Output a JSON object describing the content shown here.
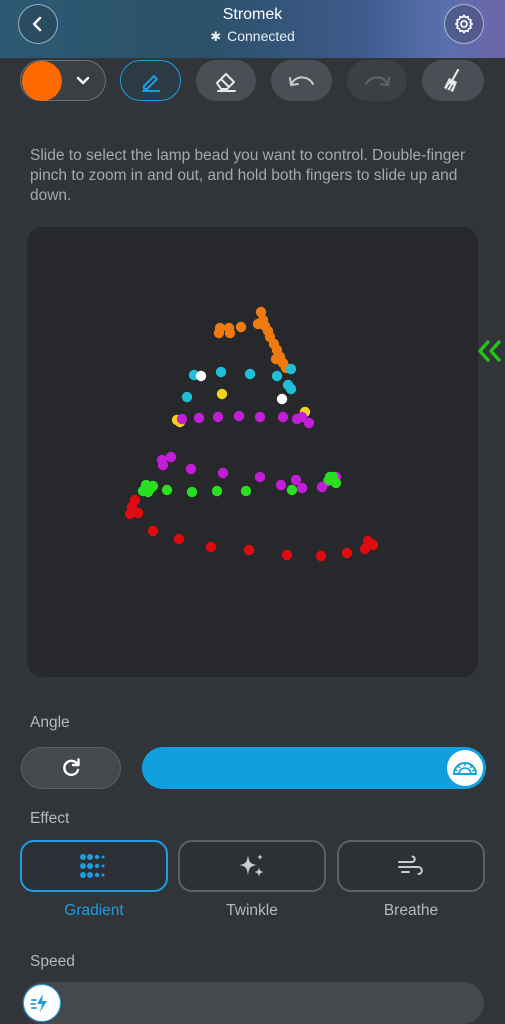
{
  "header": {
    "title": "Stromek",
    "status": "Connected",
    "back_icon": "chevron-left-icon",
    "settings_icon": "gear-icon"
  },
  "toolbar": {
    "selected_color": "#ff6a00",
    "tools": [
      {
        "name": "pen",
        "icon": "pencil-icon",
        "state": "active"
      },
      {
        "name": "eraser",
        "icon": "eraser-icon",
        "state": "enabled"
      },
      {
        "name": "undo",
        "icon": "undo-icon",
        "state": "enabled"
      },
      {
        "name": "redo",
        "icon": "redo-icon",
        "state": "disabled"
      },
      {
        "name": "clear",
        "icon": "broom-icon",
        "state": "enabled"
      }
    ]
  },
  "instructions": "Slide to select the lamp bead you want to control. Double-finger pinch to zoom in and out, and hold both fingers to slide up and down.",
  "angle": {
    "label": "Angle",
    "reset_icon": "refresh-icon",
    "slider_value_fraction": 1.0
  },
  "effect": {
    "label": "Effect",
    "options": [
      {
        "label": "Gradient",
        "icon": "dots-grid-icon",
        "selected": true
      },
      {
        "label": "Twinkle",
        "icon": "sparkle-icon",
        "selected": false
      },
      {
        "label": "Breathe",
        "icon": "wind-icon",
        "selected": false
      }
    ]
  },
  "speed": {
    "label": "Speed",
    "value_fraction": 0.0
  },
  "colors": {
    "accent": "#1e9ee0",
    "slider": "#11a0df",
    "beads": {
      "orange": "#f07a10",
      "cyan": "#1ec0d8",
      "white": "#ffffff",
      "yellow": "#f2d21e",
      "magenta": "#c21ed8",
      "green": "#28e020",
      "red": "#e00a10"
    }
  }
}
